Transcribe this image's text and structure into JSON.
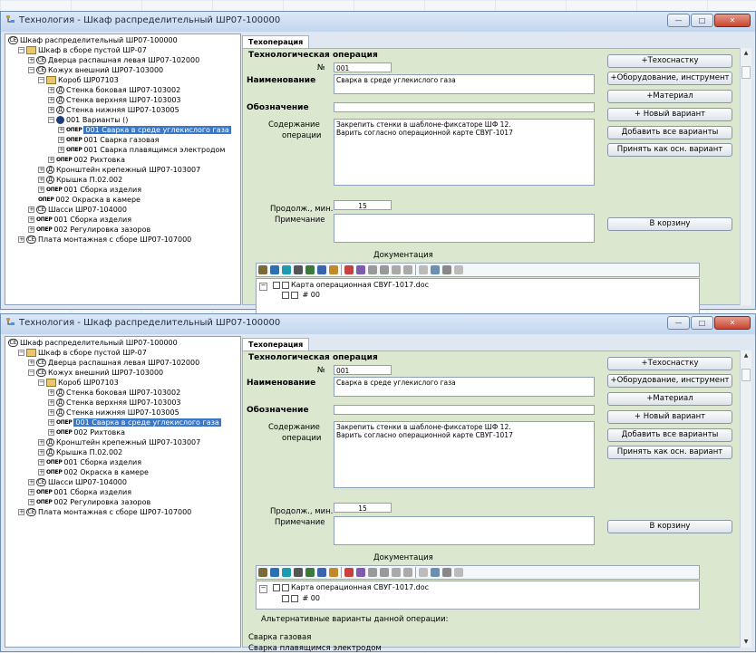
{
  "windows": [
    {
      "title": "Технология - Шкаф распределительный  ШР07-100000",
      "tree": [
        {
          "indent": 0,
          "exp": "",
          "icon": "ce",
          "label": "Шкаф распределительный  ШР07-100000"
        },
        {
          "indent": 1,
          "exp": "-",
          "icon": "asm",
          "label": "Шкаф в сборе пустой ШР-07"
        },
        {
          "indent": 2,
          "exp": "+",
          "icon": "ce",
          "label": "Дверца распашная левая ШР07-102000"
        },
        {
          "indent": 2,
          "exp": "-",
          "icon": "ce",
          "label": "Кожух внешний ШР07-103000"
        },
        {
          "indent": 3,
          "exp": "-",
          "icon": "asm",
          "label": "Короб ШР07103"
        },
        {
          "indent": 4,
          "exp": "+",
          "icon": "ad",
          "label": "Стенка боковая ШР07-103002"
        },
        {
          "indent": 4,
          "exp": "+",
          "icon": "ad",
          "label": "Стенка верхняя ШР07-103003"
        },
        {
          "indent": 4,
          "exp": "+",
          "icon": "ad",
          "label": "Стенка нижняя ШР07-103005"
        },
        {
          "indent": 4,
          "exp": "-",
          "icon": "var",
          "label": "001 Варианты ()"
        },
        {
          "indent": 5,
          "exp": "+",
          "icon": "op",
          "label": "001 Сварка в среде углекислого газа",
          "selected": true
        },
        {
          "indent": 5,
          "exp": "+",
          "icon": "op",
          "label": "001 Сварка газовая"
        },
        {
          "indent": 5,
          "exp": "+",
          "icon": "op",
          "label": "001 Сварка плавящимся электродом"
        },
        {
          "indent": 4,
          "exp": "+",
          "icon": "op",
          "label": "002 Рихтовка"
        },
        {
          "indent": 3,
          "exp": "+",
          "icon": "ad",
          "label": "Кронштейн крепежный ШР07-103007"
        },
        {
          "indent": 3,
          "exp": "+",
          "icon": "ad",
          "label": "Крышка П.02.002"
        },
        {
          "indent": 3,
          "exp": "+",
          "icon": "op",
          "label": "001 Сборка изделия"
        },
        {
          "indent": 3,
          "exp": "",
          "icon": "op",
          "label": "002 Окраска в камере"
        },
        {
          "indent": 2,
          "exp": "+",
          "icon": "ce",
          "label": "Шасси ШР07-104000"
        },
        {
          "indent": 2,
          "exp": "+",
          "icon": "op",
          "label": "001 Сборка изделия"
        },
        {
          "indent": 2,
          "exp": "+",
          "icon": "op",
          "label": "002 Регулировка зазоров"
        },
        {
          "indent": 1,
          "exp": "+",
          "icon": "ce",
          "label": "Плата монтажная с сборе ШР07-107000"
        }
      ],
      "tab": "Техоперация",
      "form": {
        "section": "Технологическая операция",
        "num_label": "№",
        "num_value": "001",
        "name_label": "Наименование",
        "name_value": "Сварка в среде углекислого газа",
        "designation_label": "Обозначение",
        "designation_value": "",
        "content_label_1": "Содержание",
        "content_label_2": "операции",
        "content_line_1": "Закрепить стенки в шаблоне-фиксаторе ШФ 12.",
        "content_line_2": "Варить согласно операционной карте СВУГ-1017",
        "duration_label": "Продолж., мин.",
        "duration_value": "15",
        "note_label": "Примечание",
        "note_value": "",
        "docs_label": "Документация",
        "doc_name": "Карта операционная СВУГ-1017.doc",
        "doc_sub": "# 00"
      },
      "buttons": [
        "+Техоснастку",
        "+Оборудование, инструмент",
        "+Материал",
        "+ Новый вариант",
        "Добавить все варианты",
        "Принять как осн. вариант",
        "В корзину"
      ]
    },
    {
      "title": "Технология - Шкаф распределительный  ШР07-100000",
      "tree": [
        {
          "indent": 0,
          "exp": "",
          "icon": "ce",
          "label": "Шкаф распределительный  ШР07-100000"
        },
        {
          "indent": 1,
          "exp": "-",
          "icon": "asm",
          "label": "Шкаф в сборе пустой ШР-07"
        },
        {
          "indent": 2,
          "exp": "+",
          "icon": "ce",
          "label": "Дверца распашная левая ШР07-102000"
        },
        {
          "indent": 2,
          "exp": "-",
          "icon": "ce",
          "label": "Кожух внешний ШР07-103000"
        },
        {
          "indent": 3,
          "exp": "-",
          "icon": "asm",
          "label": "Короб ШР07103"
        },
        {
          "indent": 4,
          "exp": "+",
          "icon": "ad",
          "label": "Стенка боковая ШР07-103002"
        },
        {
          "indent": 4,
          "exp": "+",
          "icon": "ad",
          "label": "Стенка верхняя ШР07-103003"
        },
        {
          "indent": 4,
          "exp": "+",
          "icon": "ad",
          "label": "Стенка нижняя ШР07-103005"
        },
        {
          "indent": 4,
          "exp": "+",
          "icon": "op",
          "label": "001 Сварка в среде углекислого газа",
          "selected": true
        },
        {
          "indent": 4,
          "exp": "+",
          "icon": "op",
          "label": "002 Рихтовка"
        },
        {
          "indent": 3,
          "exp": "+",
          "icon": "ad",
          "label": "Кронштейн крепежный ШР07-103007"
        },
        {
          "indent": 3,
          "exp": "+",
          "icon": "ad",
          "label": "Крышка П.02.002"
        },
        {
          "indent": 3,
          "exp": "+",
          "icon": "op",
          "label": "001 Сборка изделия"
        },
        {
          "indent": 3,
          "exp": "+",
          "icon": "op",
          "label": "002 Окраска в камере"
        },
        {
          "indent": 2,
          "exp": "+",
          "icon": "ce",
          "label": "Шасси ШР07-104000"
        },
        {
          "indent": 2,
          "exp": "+",
          "icon": "op",
          "label": "001 Сборка изделия"
        },
        {
          "indent": 2,
          "exp": "+",
          "icon": "op",
          "label": "002 Регулировка зазоров"
        },
        {
          "indent": 1,
          "exp": "+",
          "icon": "ce",
          "label": "Плата монтажная с сборе ШР07-107000"
        }
      ],
      "tab": "Техоперация",
      "form": {
        "section": "Технологическая операция",
        "num_label": "№",
        "num_value": "001",
        "name_label": "Наименование",
        "name_value": "Сварка в среде углекислого газа",
        "designation_label": "Обозначение",
        "designation_value": "",
        "content_label_1": "Содержание",
        "content_label_2": "операции",
        "content_line_1": "Закрепить стенки в шаблоне-фиксаторе ШФ 12.",
        "content_line_2": "Варить согласно операционной карте СВУГ-1017",
        "duration_label": "Продолж., мин.",
        "duration_value": "15",
        "note_label": "Примечание",
        "note_value": "",
        "docs_label": "Документация",
        "doc_name": "Карта операционная СВУГ-1017.doc",
        "doc_sub": "# 00",
        "alt_label": "Альтернативные варианты данной операции:",
        "alt_items": [
          "Сварка газовая",
          "Сварка плавящимся электродом"
        ]
      },
      "buttons": [
        "+Техоснастку",
        "+Оборудование, инструмент",
        "+Материал",
        "+ Новый вариант",
        "Добавить все варианты",
        "Принять как осн. вариант",
        "В корзину"
      ]
    }
  ],
  "window_controls": {
    "minimize": "—",
    "maximize": "□",
    "close": "✕"
  },
  "icon_glyphs": {
    "ce": "CE",
    "ad": "Д",
    "op": "ОПЕР"
  },
  "colors": {
    "selection": "#3a78c8",
    "panel": "#dbe8cf",
    "close": "#c8452f"
  }
}
